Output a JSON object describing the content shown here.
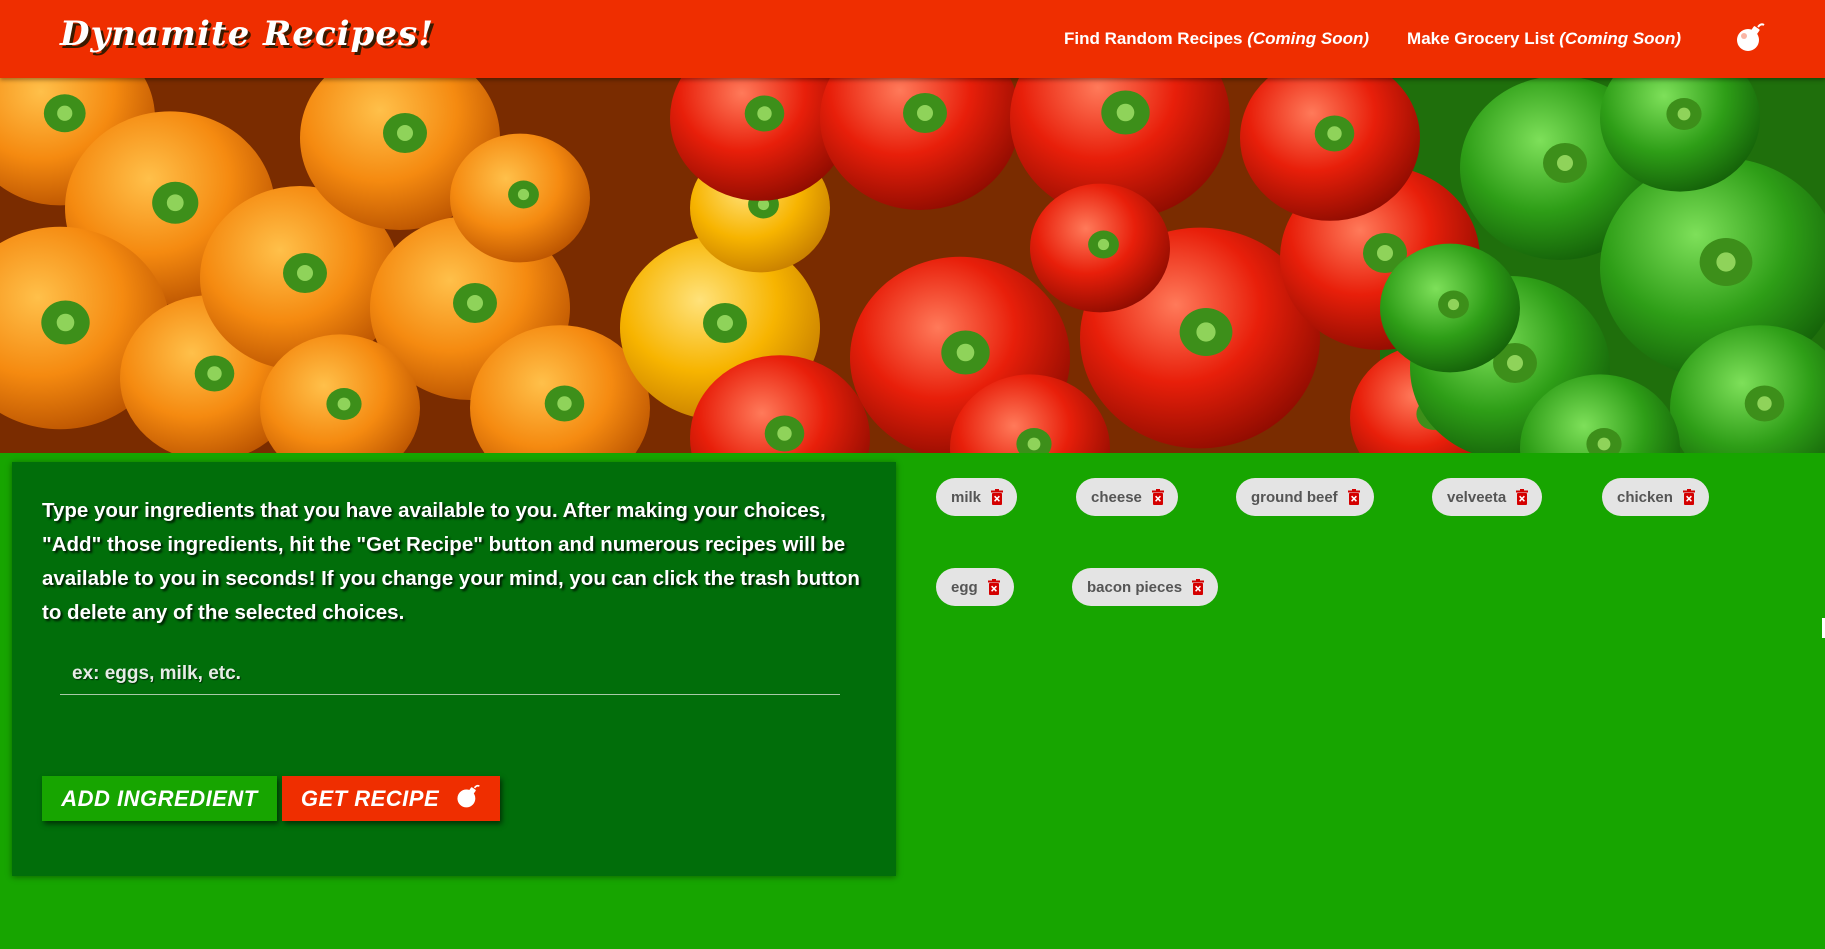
{
  "navbar": {
    "brand": "Dynamite Recipes!",
    "links": [
      {
        "label": "Find Random Recipes",
        "note": "(Coming Soon)"
      },
      {
        "label": "Make Grocery List",
        "note": "(Coming Soon)"
      }
    ],
    "icon": "bomb-icon"
  },
  "hero": {
    "subject": "peppers-image"
  },
  "panel": {
    "instructions": "Type your ingredients that you have available to you. After making your choices, \"Add\" those ingredients, hit the \"Get Recipe\" button and numerous recipes will be available to you in seconds! If you change your mind, you can click the trash button to delete any of the selected choices.",
    "input": {
      "placeholder": "ex: eggs, milk, etc.",
      "value": ""
    },
    "add_button": "ADD INGREDIENT",
    "get_button": "GET RECIPE"
  },
  "ingredients": [
    "milk",
    "cheese",
    "ground beef",
    "velveeta",
    "chicken",
    "egg",
    "bacon pieces"
  ],
  "colors": {
    "navbar": "#ef2e00",
    "page": "#17a500",
    "panel": "#016e0a",
    "chip": "#e4e4e4",
    "trash": "#d40000"
  }
}
